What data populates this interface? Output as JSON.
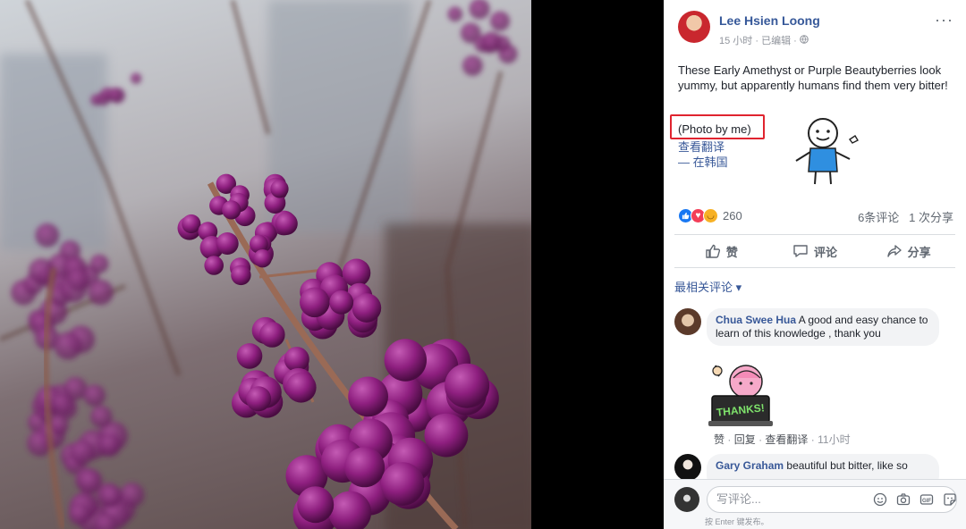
{
  "post": {
    "author": "Lee Hsien Loong",
    "time": "15 小时",
    "edited": "已编辑",
    "text": "These Early Amethyst or Purple Beautyberries look yummy, but apparently humans find them very bitter!",
    "photo_credit": "(Photo by me)",
    "translate": "查看翻译",
    "location": "— 在韩国",
    "more": "···"
  },
  "reactions": {
    "count": "260",
    "comments": "6条评论",
    "shares": "1 次分享"
  },
  "actions": {
    "like": "赞",
    "comment": "评论",
    "share": "分享"
  },
  "comments_sort": "最相关评论 ▾",
  "comments": [
    {
      "name": "Chua Swee Hua",
      "text": "A good and easy chance to learn of this knowledge , thank you",
      "sticker_text": "THANKS!",
      "like": "赞",
      "reply": "回复",
      "translate": "查看翻译",
      "time": "11小时"
    },
    {
      "name": "Gary Graham",
      "text": "beautiful but bitter, like so"
    }
  ],
  "composer": {
    "placeholder": "写评论...",
    "hint": "按 Enter 键发布。"
  },
  "colors": {
    "link": "#385898",
    "author": "#365899",
    "highlight": "#e0242f",
    "berry": "#8e1f7f"
  }
}
